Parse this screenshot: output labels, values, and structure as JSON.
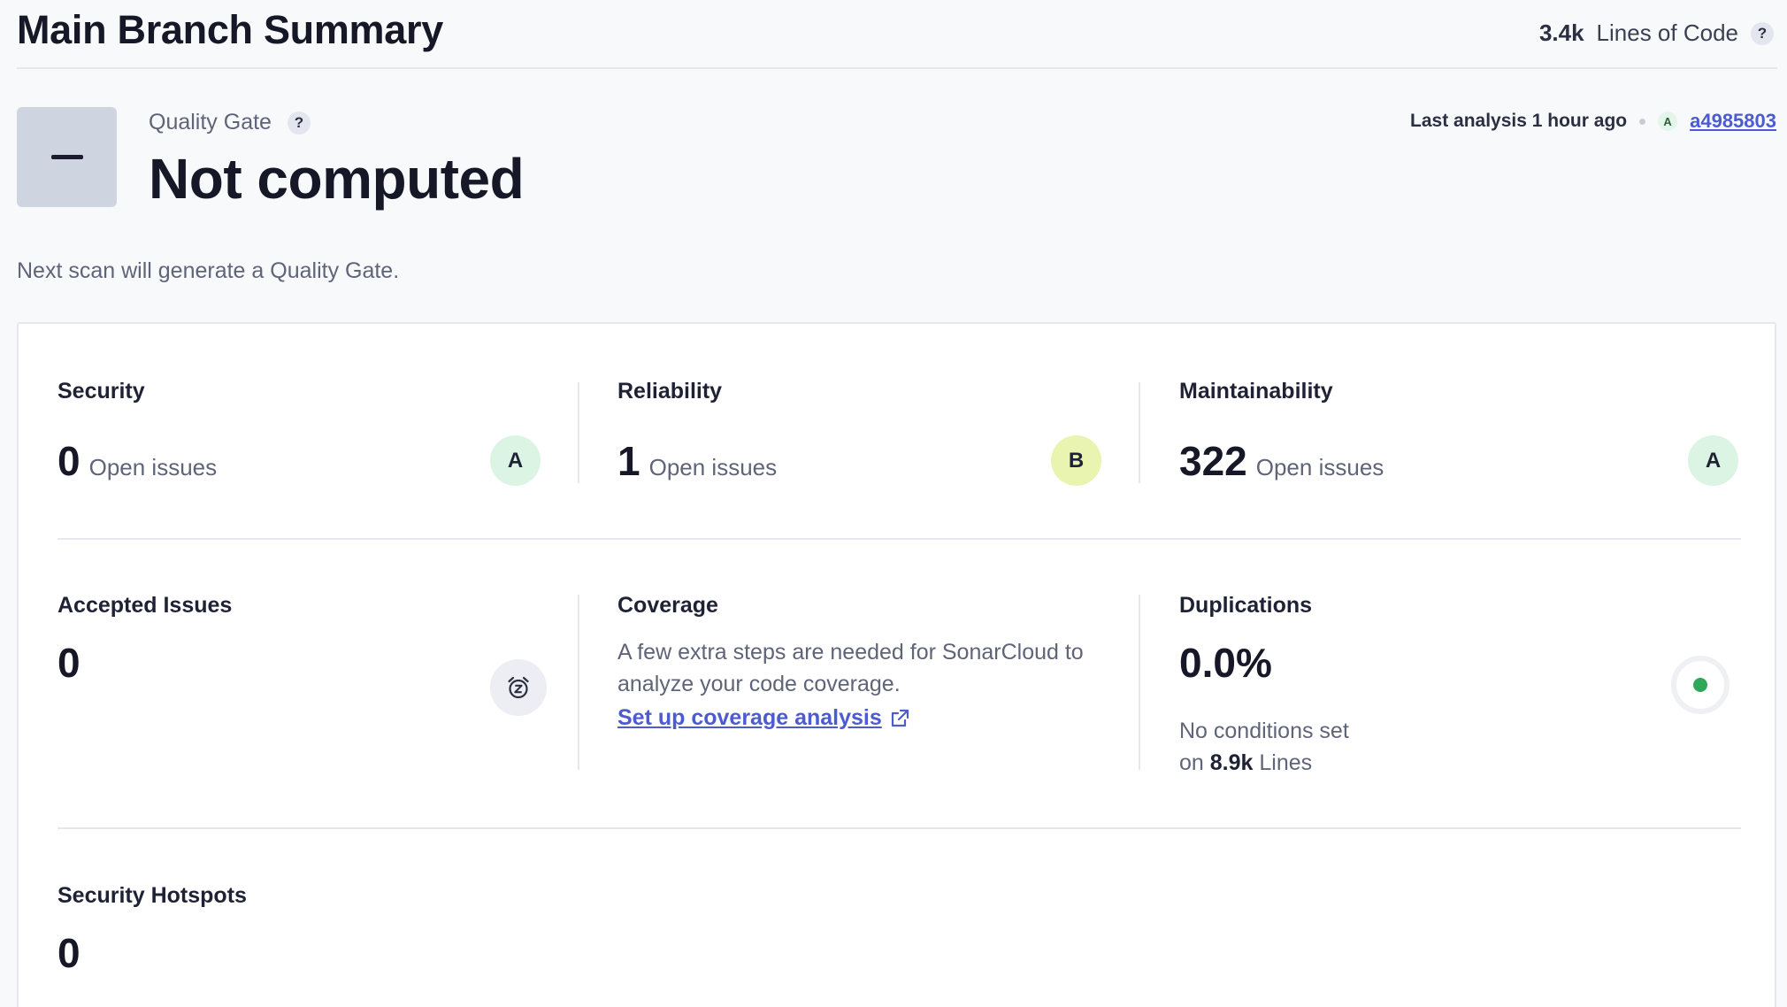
{
  "header": {
    "title": "Main Branch Summary",
    "loc_value": "3.4k",
    "loc_label": "Lines of Code",
    "help_glyph": "?"
  },
  "quality_gate": {
    "label": "Quality Gate",
    "help_glyph": "?",
    "status": "Not computed",
    "next_scan": "Next scan will generate a Quality Gate."
  },
  "analysis": {
    "text": "Last analysis 1 hour ago",
    "badge": "A",
    "commit": "a4985803"
  },
  "metrics": {
    "security": {
      "title": "Security",
      "value": "0",
      "suffix": "Open issues",
      "rating": "A"
    },
    "reliability": {
      "title": "Reliability",
      "value": "1",
      "suffix": "Open issues",
      "rating": "B"
    },
    "maintainability": {
      "title": "Maintainability",
      "value": "322",
      "suffix": "Open issues",
      "rating": "A"
    },
    "accepted": {
      "title": "Accepted Issues",
      "value": "0",
      "icon": "alarm-snooze-icon"
    },
    "coverage": {
      "title": "Coverage",
      "description": "A few extra steps are needed for SonarCloud to analyze your code coverage.",
      "link": "Set up coverage analysis",
      "link_icon": "external-link-icon"
    },
    "duplications": {
      "title": "Duplications",
      "value": "0.0%",
      "note_line1": "No conditions set",
      "note_prefix": "on",
      "note_value": "8.9k",
      "note_suffix": "Lines"
    },
    "hotspots": {
      "title": "Security Hotspots",
      "value": "0"
    }
  },
  "colors": {
    "rating_a": "#dbf4e3",
    "rating_b": "#e9f4b1",
    "link": "#4c5bd0",
    "duplication_dot": "#2fa85a"
  }
}
